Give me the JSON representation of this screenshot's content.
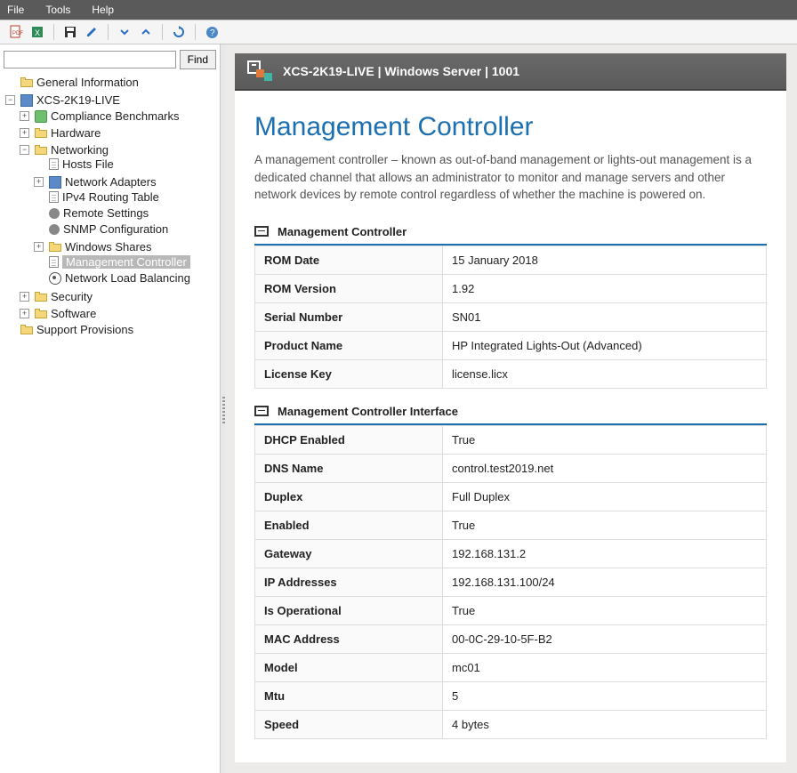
{
  "menu": {
    "file": "File",
    "tools": "Tools",
    "help": "Help"
  },
  "search": {
    "placeholder": "",
    "find_btn": "Find"
  },
  "sidebar": {
    "general_info": "General Information",
    "host_root": "XCS-2K19-LIVE",
    "compliance": "Compliance Benchmarks",
    "hardware": "Hardware",
    "networking": "Networking",
    "hosts_file": "Hosts File",
    "net_adapters": "Network Adapters",
    "ipv4_routing": "IPv4 Routing Table",
    "remote_settings": "Remote Settings",
    "snmp_config": "SNMP Configuration",
    "win_shares": "Windows Shares",
    "mgmt_controller": "Management Controller",
    "nlb": "Network Load Balancing",
    "security": "Security",
    "software": "Software",
    "support": "Support Provisions"
  },
  "crumb": "XCS-2K19-LIVE | Windows Server | 1001",
  "page": {
    "title": "Management Controller",
    "description": "A management controller – known as out-of-band management or lights-out management is a dedicated channel that allows an administrator to monitor and manage servers and other network devices by remote control regardless of whether the machine is powered on."
  },
  "sections": [
    {
      "title": "Management Controller",
      "rows": [
        {
          "k": "ROM Date",
          "v": "15 January 2018"
        },
        {
          "k": "ROM Version",
          "v": "1.92"
        },
        {
          "k": "Serial Number",
          "v": "SN01"
        },
        {
          "k": "Product Name",
          "v": "HP Integrated Lights-Out (Advanced)"
        },
        {
          "k": "License Key",
          "v": "license.licx"
        }
      ]
    },
    {
      "title": "Management Controller Interface",
      "rows": [
        {
          "k": "DHCP Enabled",
          "v": "True"
        },
        {
          "k": "DNS Name",
          "v": "control.test2019.net"
        },
        {
          "k": "Duplex",
          "v": "Full Duplex"
        },
        {
          "k": "Enabled",
          "v": "True"
        },
        {
          "k": "Gateway",
          "v": "192.168.131.2"
        },
        {
          "k": "IP Addresses",
          "v": "192.168.131.100/24"
        },
        {
          "k": "Is Operational",
          "v": "True"
        },
        {
          "k": "MAC Address",
          "v": "00-0C-29-10-5F-B2"
        },
        {
          "k": "Model",
          "v": "mc01"
        },
        {
          "k": "Mtu",
          "v": "5"
        },
        {
          "k": "Speed",
          "v": "4 bytes"
        }
      ]
    }
  ]
}
